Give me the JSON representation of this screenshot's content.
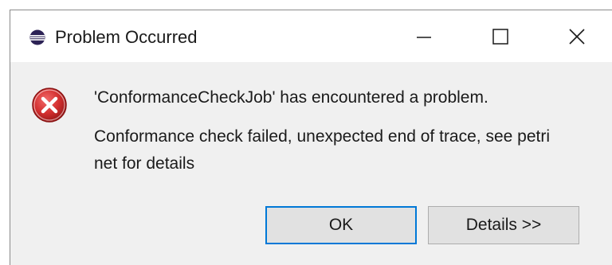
{
  "window": {
    "title": "Problem Occurred",
    "app_icon": "eclipse-icon",
    "controls": {
      "minimize_icon": "minimize-icon",
      "maximize_icon": "maximize-icon",
      "close_icon": "close-icon"
    }
  },
  "message": {
    "icon": "error-icon",
    "title": "'ConformanceCheckJob' has encountered a problem.",
    "detail": "Conformance check failed, unexpected end of trace, see petri net for details"
  },
  "buttons": {
    "ok_label": "OK",
    "details_label": "Details >>"
  },
  "colors": {
    "dialog_background": "#f0f0f0",
    "titlebar_background": "#ffffff",
    "focus_border": "#0078d7",
    "button_face": "#e1e1e1",
    "error_red": "#d32f2f"
  }
}
